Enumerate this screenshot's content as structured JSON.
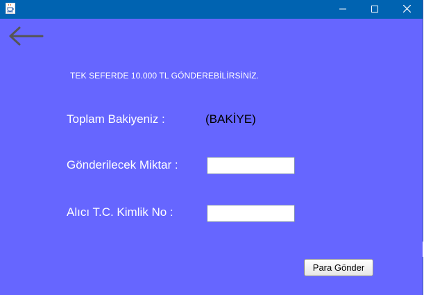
{
  "window": {
    "title": "",
    "app_icon": "java-cup-icon",
    "controls": {
      "minimize_icon": "minimize-icon",
      "maximize_icon": "maximize-icon",
      "close_icon": "close-icon"
    },
    "colors": {
      "titlebar": "#0063b1",
      "background": "#6666ff"
    }
  },
  "nav": {
    "back_icon": "back-arrow-icon"
  },
  "form": {
    "info_text": "TEK SEFERDE 10.000 TL GÖNDEREBİLİRSİNİZ.",
    "balance_label": "Toplam Bakiyeniz :",
    "balance_value": "(BAKİYE)",
    "amount_label": "Gönderilecek Miktar :",
    "amount_value": "",
    "tc_label": "Alıcı T.C. Kimlik No :",
    "tc_value": "",
    "send_button_label": "Para Gönder"
  }
}
